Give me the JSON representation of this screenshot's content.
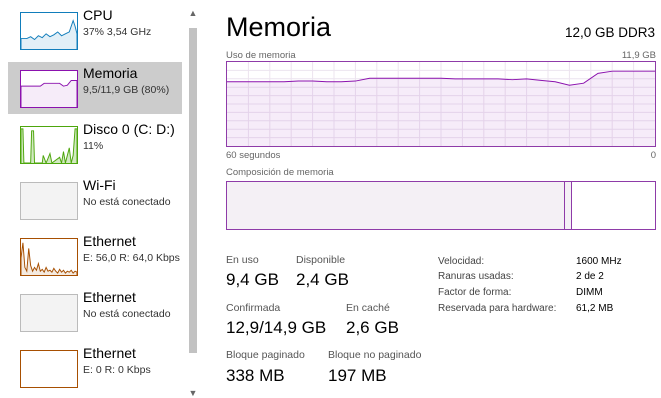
{
  "sidebar": {
    "items": [
      {
        "title": "CPU",
        "subtitle": "37% 3,54 GHz",
        "color": "#117dbb"
      },
      {
        "title": "Memoria",
        "subtitle": "9,5/11,9 GB (80%)",
        "color": "#8b12ae",
        "selected": true
      },
      {
        "title": "Disco 0 (C: D:)",
        "subtitle": "11%",
        "color": "#4da60c"
      },
      {
        "title": "Wi-Fi",
        "subtitle": "No está conectado",
        "color": "#a74f01"
      },
      {
        "title": "Ethernet",
        "subtitle": "E: 56,0 R: 64,0 Kbps",
        "color": "#a74f01"
      },
      {
        "title": "Ethernet",
        "subtitle": "No está conectado",
        "color": "#a74f01"
      },
      {
        "title": "Ethernet",
        "subtitle": "E: 0 R: 0 Kbps",
        "color": "#a74f01"
      }
    ]
  },
  "header": {
    "title": "Memoria",
    "spec": "12,0 GB DDR3"
  },
  "usage": {
    "label": "Uso de memoria",
    "max_label": "11,9 GB",
    "time_label": "60 segundos",
    "zero_label": "0",
    "accent": "#8b12ae"
  },
  "composition": {
    "label": "Composición de memoria",
    "in_use_fraction": 0.79,
    "modified_fraction": 0.015
  },
  "stats": {
    "in_use_label": "En uso",
    "in_use_value": "9,4 GB",
    "available_label": "Disponible",
    "available_value": "2,4 GB",
    "committed_label": "Confirmada",
    "committed_value": "12,9/14,9 GB",
    "cached_label": "En caché",
    "cached_value": "2,6 GB",
    "paged_label": "Bloque paginado",
    "paged_value": "338 MB",
    "nonpaged_label": "Bloque no paginado",
    "nonpaged_value": "197 MB"
  },
  "specs": {
    "speed_label": "Velocidad:",
    "speed_value": "1600 MHz",
    "slots_label": "Ranuras usadas:",
    "slots_value": "2 de 2",
    "form_label": "Factor de forma:",
    "form_value": "DIMM",
    "reserved_label": "Reservada para hardware:",
    "reserved_value": "61,2 MB"
  },
  "chart_data": {
    "type": "area",
    "ylim": [
      0,
      11.9
    ],
    "x": [
      0,
      2,
      4,
      6,
      8,
      10,
      12,
      14,
      16,
      18,
      20,
      22,
      24,
      26,
      28,
      30,
      32,
      34,
      36,
      38,
      40,
      42,
      44,
      46,
      48,
      50,
      52,
      54,
      56,
      58,
      60
    ],
    "y": [
      9.1,
      9.1,
      9.1,
      9.1,
      9.1,
      9.2,
      9.2,
      9.1,
      9.1,
      9.2,
      9.6,
      9.6,
      9.6,
      9.6,
      9.6,
      9.6,
      9.5,
      9.5,
      9.5,
      9.5,
      9.4,
      9.5,
      9.3,
      9.1,
      8.6,
      8.9,
      10.3,
      10.6,
      10.6,
      10.6,
      10.6
    ]
  }
}
